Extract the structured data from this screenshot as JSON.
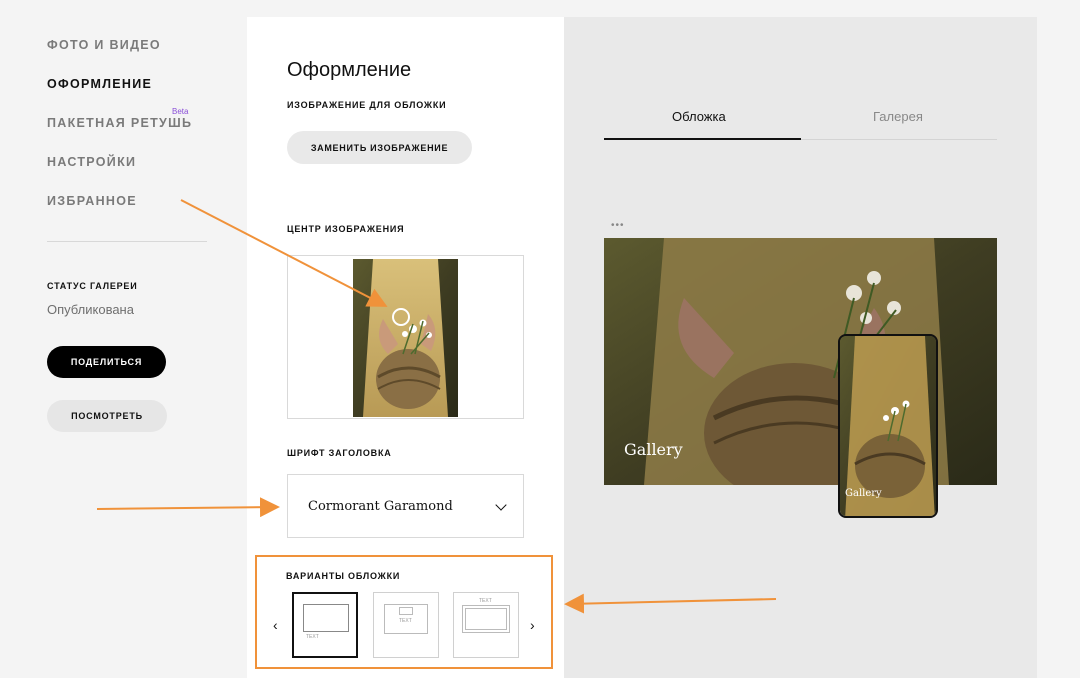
{
  "sidebar": {
    "items": [
      {
        "label": "ФОТО И ВИДЕО"
      },
      {
        "label": "ОФОРМЛЕНИЕ"
      },
      {
        "label": "ПАКЕТНАЯ РЕТУШЬ"
      },
      {
        "label": "НАСТРОЙКИ"
      },
      {
        "label": "ИЗБРАННОЕ"
      }
    ],
    "beta_badge": "Beta",
    "status_title": "СТАТУС ГАЛЕРЕИ",
    "status_value": "Опубликована",
    "share_button": "ПОДЕЛИТЬСЯ",
    "view_button": "ПОСМОТРЕТЬ"
  },
  "panel": {
    "title": "Оформление",
    "cover_image_label": "ИЗОБРАЖЕНИЕ ДЛЯ ОБЛОЖКИ",
    "replace_button": "ЗАМЕНИТЬ ИЗОБРАЖЕНИЕ",
    "focus_label": "ЦЕНТР ИЗОБРАЖЕНИЯ",
    "font_label": "ШРИФТ ЗАГОЛОВКА",
    "font_value": "Cormorant Garamond",
    "variants_label": "ВАРИАНТЫ ОБЛОЖКИ",
    "variant_text": "TEXT"
  },
  "preview": {
    "tabs": [
      {
        "label": "Обложка"
      },
      {
        "label": "Галерея"
      }
    ],
    "dots": "•••",
    "cover_caption": "Gallery",
    "phone_caption": "Gallery"
  },
  "colors": {
    "accent_arrow": "#f0923a",
    "beta": "#8a4fd8"
  }
}
